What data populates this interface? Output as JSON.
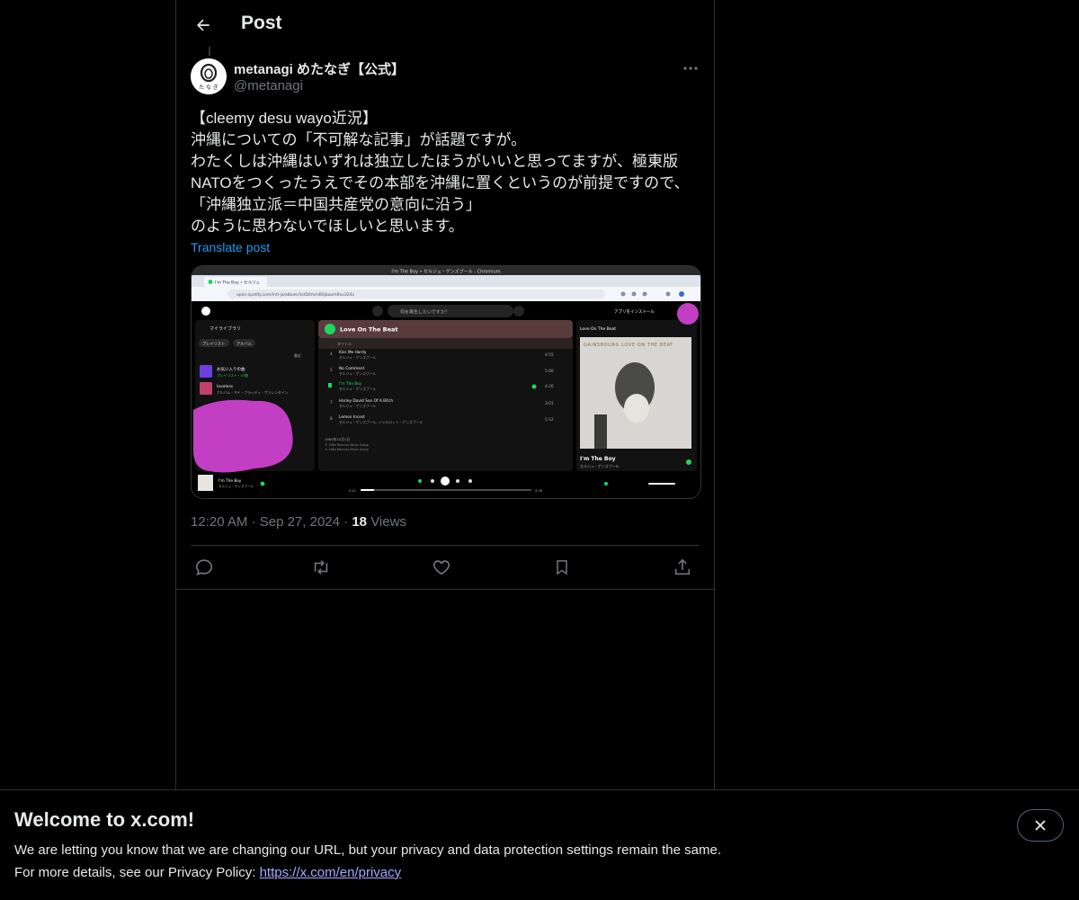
{
  "header": {
    "title": "Post"
  },
  "post": {
    "display_name": "metanagi めたなぎ【公式】",
    "handle": "@metanagi",
    "avatar_text": "た な ぎ",
    "text_lines": [
      "【cleemy desu wayo近況】",
      "沖縄についての「不可解な記事」が話題ですが。",
      "わたくしは沖縄はいずれは独立したほうがいいと思ってますが、極東版",
      "NATOをつくったうえでその本部を沖縄に置くというのが前提ですので、",
      "「沖縄独立派＝中国共産党の意向に沿う」",
      "のように思わないでほしいと思います。"
    ],
    "translate_label": "Translate post",
    "time": "12:20 AM",
    "separator": "·",
    "date": "Sep 27, 2024",
    "views_count": "18",
    "views_label": "Views"
  },
  "media": {
    "window_title": "I'm The Boy • セルジュ・ゲンズブール - Chromium",
    "tab_label": "I'm The Boy • セルジュ",
    "address": "open.spotify.com/intl-ja/album/3stD4mmB0jbaom9xu324s",
    "search_placeholder": "何を再生したいですか？",
    "install_label": "アプリをインストール",
    "library_label": "マイライブラリ",
    "chip_playlist": "プレイリスト",
    "chip_album": "アルバム",
    "recent_label": "最近",
    "lib_items": [
      {
        "title": "お気に入りの曲",
        "sub": "プレイリスト・47曲"
      },
      {
        "title": "loveless",
        "sub": "アルバム・マイ・ブラッディ・ヴァレンタイン"
      }
    ],
    "album_title": "Love On The Beat",
    "col_header": "タイトル",
    "tracks": [
      {
        "num": "4",
        "title": "Kiss Me Hardy",
        "artist": "セルジュ・ゲンズブール",
        "time": "4:55"
      },
      {
        "num": "5",
        "title": "No Comment",
        "artist": "セルジュ・ゲンズブール",
        "time": "5:00"
      },
      {
        "num": "",
        "title": "I'm The Boy",
        "artist": "セルジュ・ゲンズブール",
        "time": "4:26"
      },
      {
        "num": "7",
        "title": "Harley David Son Of A Bitch",
        "artist": "セルジュ・ゲンズブール",
        "time": "3:01"
      },
      {
        "num": "8",
        "title": "Lemon Incest",
        "artist": "セルジュ・ゲンズブール, シャルロット・ゲンズブール",
        "time": "5:12"
      }
    ],
    "release_date": "1984年10月1日",
    "copyright1": "© 1984 Mercury Music Group",
    "copyright2": "℗ 1984 Mercury Music Group",
    "np_panel_title": "Love On The Beat",
    "cover_text": "GAINSBOURG LOVE ON THE BEAT",
    "np_track": "I'm The Boy",
    "np_artist": "セルジュ・ゲンズブール",
    "bar_track": "I'm The Boy",
    "bar_artist": "セルジュ・ゲンズブール",
    "time_elapsed": "0:21",
    "time_total": "4:26",
    "progress": 0.08,
    "colors": {
      "spotify_green": "#1ed760",
      "redaction": "#c23fc3",
      "album_header": "#5a3b3b"
    }
  },
  "banner": {
    "title": "Welcome to x.com!",
    "line1": "We are letting you know that we are changing our URL, but your privacy and data protection settings remain the same.",
    "line2_prefix": "For more details, see our Privacy Policy: ",
    "link": "https://x.com/en/privacy"
  },
  "icons": [
    "back-arrow-icon",
    "more-icon",
    "reply-icon",
    "repost-icon",
    "like-icon",
    "bookmark-icon",
    "share-icon",
    "close-icon"
  ]
}
